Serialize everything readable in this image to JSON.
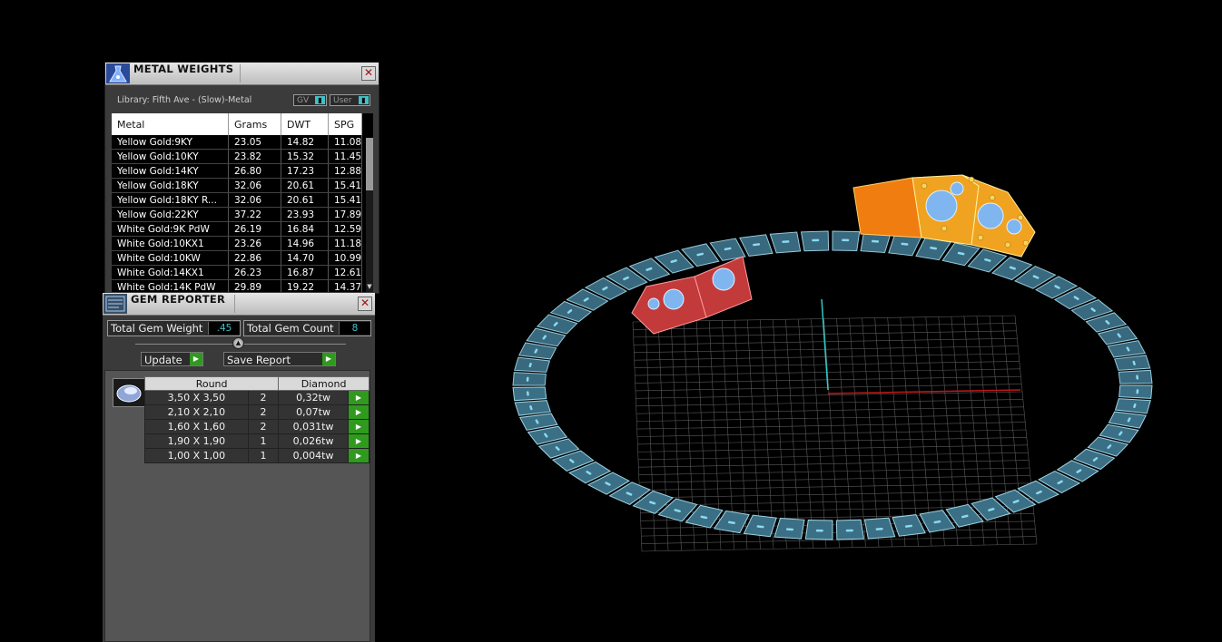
{
  "metal_weights": {
    "title": "METAL WEIGHTS",
    "library_label": "Library: Fifth Ave - (Slow)-Metal",
    "toggles": [
      {
        "label": "GV"
      },
      {
        "label": "User"
      }
    ],
    "columns": [
      "Metal",
      "Grams",
      "DWT",
      "SPG"
    ],
    "rows": [
      [
        "Yellow Gold:9KY",
        "23.05",
        "14.82",
        "11.08"
      ],
      [
        "Yellow Gold:10KY",
        "23.82",
        "15.32",
        "11.45"
      ],
      [
        "Yellow Gold:14KY",
        "26.80",
        "17.23",
        "12.88"
      ],
      [
        "Yellow Gold:18KY",
        "32.06",
        "20.61",
        "15.41"
      ],
      [
        "Yellow Gold:18KY R...",
        "32.06",
        "20.61",
        "15.41"
      ],
      [
        "Yellow Gold:22KY",
        "37.22",
        "23.93",
        "17.89"
      ],
      [
        "White Gold:9K PdW",
        "26.19",
        "16.84",
        "12.59"
      ],
      [
        "White Gold:10KX1",
        "23.26",
        "14.96",
        "11.18"
      ],
      [
        "White Gold:10KW",
        "22.86",
        "14.70",
        "10.99"
      ],
      [
        "White Gold:14KX1",
        "26.23",
        "16.87",
        "12.61"
      ],
      [
        "White Gold:14K PdW",
        "29.89",
        "19.22",
        "14.37"
      ]
    ]
  },
  "gem_reporter": {
    "title": "GEM REPORTER",
    "total_weight_label": "Total Gem Weight",
    "total_weight_value": ".45",
    "total_count_label": "Total Gem Count",
    "total_count_value": "8",
    "update_label": "Update",
    "save_label": "Save Report",
    "table_headers": [
      "Round",
      "Diamond"
    ],
    "rows": [
      [
        "3,50 X 3,50",
        "2",
        "0,32tw"
      ],
      [
        "2,10 X 2,10",
        "2",
        "0,07tw"
      ],
      [
        "1,60 X 1,60",
        "2",
        "0,031tw"
      ],
      [
        "1,90 X 1,90",
        "1",
        "0,026tw"
      ],
      [
        "1,00 X 1,00",
        "1",
        "0,004tw"
      ]
    ]
  },
  "colors": {
    "background": "#000000",
    "band": "#3b6f86",
    "band_edge": "#8ad9ef",
    "gold": "#f0a320",
    "orange": "#f07d10",
    "red_setting": "#c23a3a",
    "gem": "#7fb6f0",
    "accent_cyan": "#41c0c6",
    "go_green": "#2f9a1e"
  }
}
